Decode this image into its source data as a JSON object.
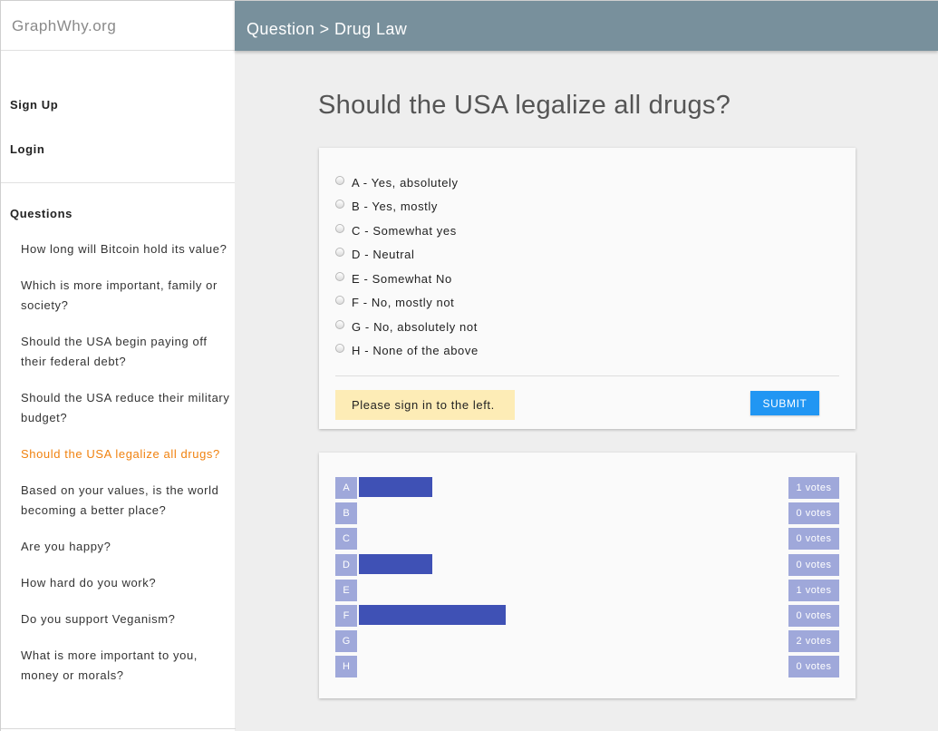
{
  "sidebar": {
    "brand": "GraphWhy.org",
    "signup_label": "Sign Up",
    "login_label": "Login",
    "questions_heading": "Questions",
    "questions": [
      "How long will Bitcoin hold its value?",
      "Which is more important, family or society?",
      "Should the USA begin paying off their federal debt?",
      "Should the USA reduce their military budget?",
      "Should the USA legalize all drugs?",
      "Based on your values, is the world becoming a better place?",
      "Are you happy?",
      "How hard do you work?",
      "Do you support Veganism?",
      "What is more important to you, money or morals?"
    ],
    "active_question_index": 4
  },
  "header": {
    "breadcrumb": "Question > Drug Law"
  },
  "main": {
    "title": "Should the USA legalize all drugs?",
    "options": [
      "A - Yes, absolutely",
      "B - Yes, mostly",
      "C - Somewhat yes",
      "D - Neutral",
      "E - Somewhat No",
      "F - No, mostly not",
      "G - No, absolutely not",
      "H - None of the above"
    ],
    "notice": "Please sign in to the left.",
    "submit_label": "SUBMIT"
  },
  "results": {
    "labels": [
      "A",
      "B",
      "C",
      "D",
      "E",
      "F",
      "G",
      "H"
    ],
    "votes": [
      "1 votes",
      "0 votes",
      "0 votes",
      "0 votes",
      "1 votes",
      "0 votes",
      "2 votes",
      "0 votes"
    ],
    "bar_values": [
      1,
      0,
      0,
      1,
      0,
      2,
      0,
      0
    ]
  },
  "colors": {
    "accent": "#2196f3",
    "header": "#78909c",
    "active_link": "#f0820f",
    "bar": "#3f51b5",
    "label_bg": "#9fa8da",
    "notice_bg": "#fdecb6"
  }
}
